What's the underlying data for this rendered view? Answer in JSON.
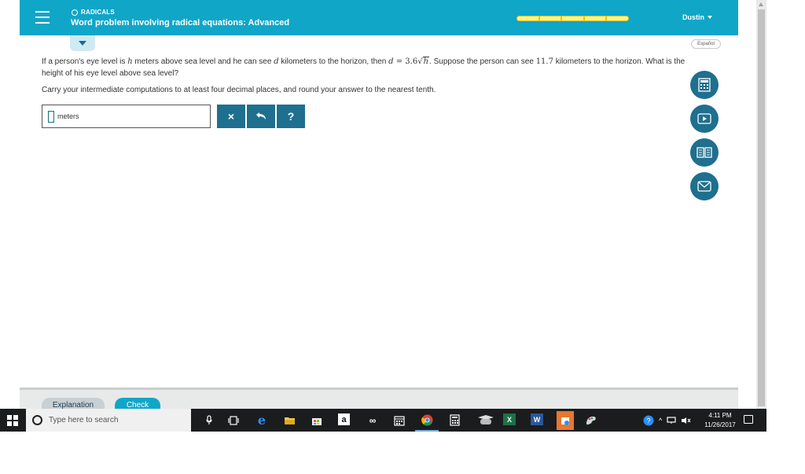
{
  "header": {
    "topic_label": "RADICALS",
    "lesson_title": "Word problem involving radical equations: Advanced",
    "user_name": "Dustin",
    "progress_segments": 5,
    "accent_color": "#10a6c8"
  },
  "language_toggle": "Español",
  "question": {
    "part1": "If a person's eye level is ",
    "var_h": "h",
    "part2": " meters above sea level and he can see ",
    "var_d": "d",
    "part3": " kilometers to the horizon, then ",
    "eq_left": "d",
    "eq_sign": " = ",
    "eq_coef": "3.6",
    "eq_radicand": "h",
    "part4": ". Suppose the person can see ",
    "distance_value": "11.7",
    "part5": " kilometers to the horizon. What is the height of his eye level above sea level?",
    "instruction": "Carry your intermediate computations to at least four decimal places, and round your answer to the nearest tenth."
  },
  "answer": {
    "value": "",
    "unit": "meters"
  },
  "tools": {
    "clear_label": "×",
    "undo_icon": "undo-icon",
    "help_label": "?"
  },
  "right_tools": [
    "calculator-icon",
    "video-icon",
    "textbook-icon",
    "message-icon"
  ],
  "footer": {
    "explanation_label": "Explanation",
    "check_label": "Check"
  },
  "taskbar": {
    "search_placeholder": "Type here to search",
    "time": "4:11 PM",
    "date": "11/26/2017"
  }
}
